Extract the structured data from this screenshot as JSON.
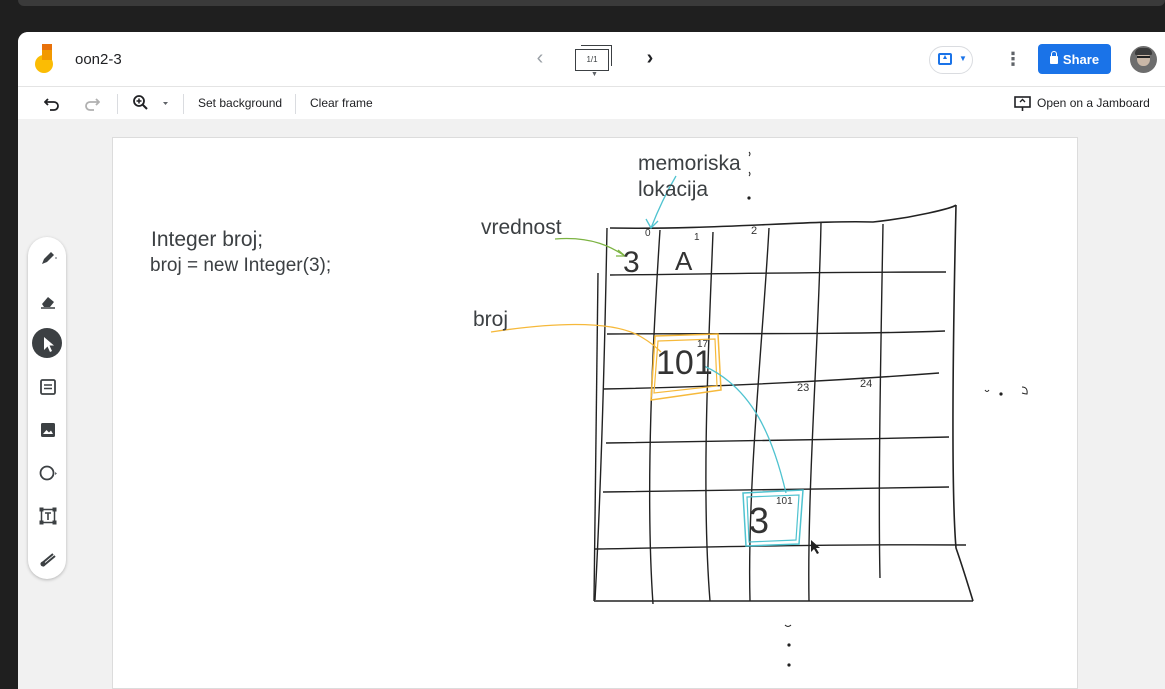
{
  "header": {
    "doc_title": "oon2-3",
    "frame_indicator": "1/1",
    "share_label": "Share"
  },
  "toolbar": {
    "set_background": "Set background",
    "clear_frame": "Clear frame",
    "open_jamboard": "Open on a Jamboard"
  },
  "canvas": {
    "code_line1": "Integer broj;",
    "code_line2": "broj = new Integer(3);",
    "label_memoriska": "memoriska",
    "label_lokacija": "lokacija",
    "label_vrednost": "vrednost",
    "label_broj": "broj",
    "cell_value_3": "3",
    "cell_value_A": "A",
    "cell_value_101": "101",
    "cell_value_3b": "3",
    "addr_0": "0",
    "addr_1": "1",
    "addr_2": "2",
    "addr_17": "17",
    "addr_23": "23",
    "addr_24": "24",
    "addr_101": "101"
  },
  "colors": {
    "accent": "#1a73e8",
    "ink": "#333333",
    "green_ink": "#7cb342",
    "orange_ink": "#f6b93b",
    "cyan_ink": "#4fc3d0"
  },
  "tools": [
    "pen-icon",
    "eraser-icon",
    "select-icon",
    "sticky-note-icon",
    "image-icon",
    "circle-icon",
    "text-box-icon",
    "laser-icon"
  ]
}
